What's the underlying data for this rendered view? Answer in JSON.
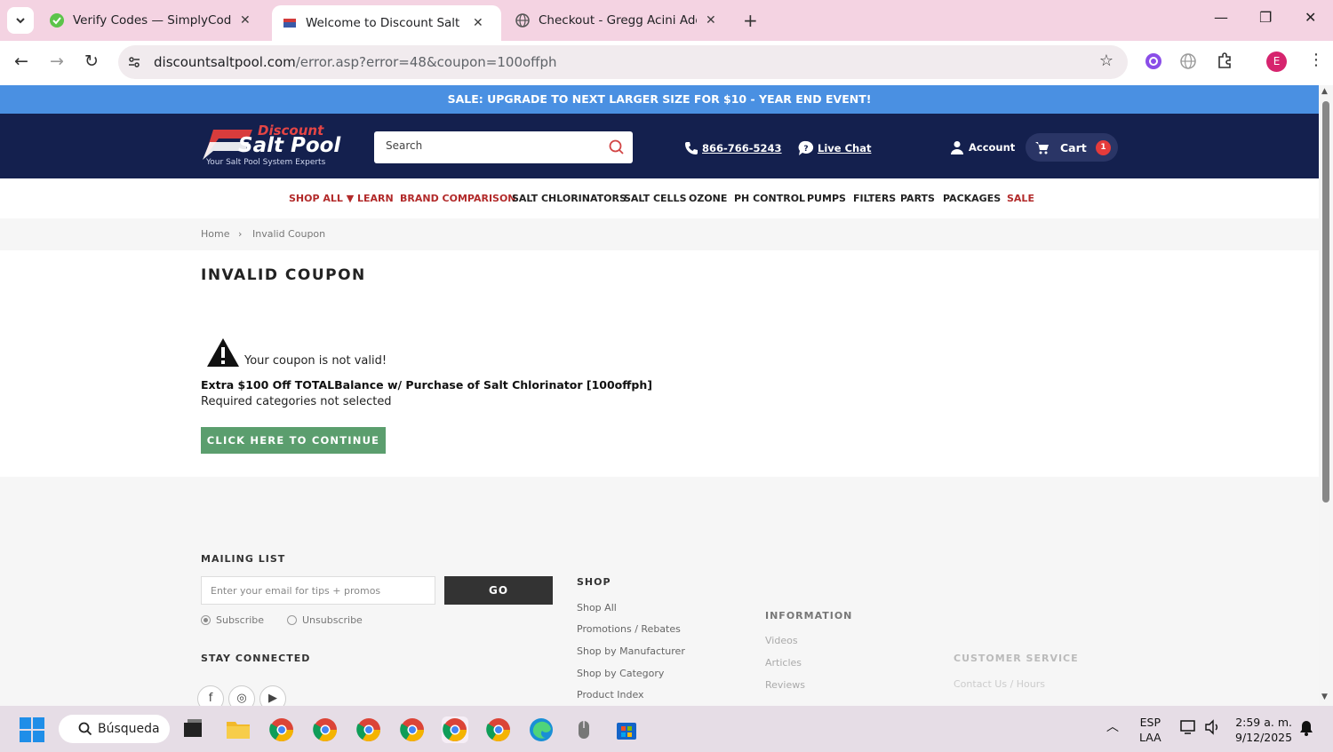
{
  "browser": {
    "tabs": [
      {
        "title": "Verify Codes — SimplyCodes",
        "active": false
      },
      {
        "title": "Welcome to Discount Salt Pool",
        "active": true
      },
      {
        "title": "Checkout - Gregg Acini Adoree",
        "active": false
      }
    ],
    "url_host": "discountsaltpool.com",
    "url_path": "/error.asp?error=48&coupon=100offph",
    "profile_initial": "E"
  },
  "site": {
    "sale_banner": "SALE: UPGRADE TO NEXT LARGER SIZE FOR $10 - YEAR END EVENT!",
    "logo": {
      "line1": "Discount",
      "line2": "Salt Pool",
      "tagline": "Your Salt Pool System Experts"
    },
    "search_placeholder": "Search",
    "phone": "866-766-5243",
    "live_chat": "Live Chat",
    "account": "Account",
    "cart_label": "Cart",
    "cart_count": "1",
    "nav": [
      {
        "label": "SHOP ALL ▼",
        "red": true
      },
      {
        "label": "LEARN",
        "red": true
      },
      {
        "label": "BRAND COMPARISON",
        "red": true
      },
      {
        "label": "SALT CHLORINATORS",
        "red": false
      },
      {
        "label": "SALT CELLS",
        "red": false
      },
      {
        "label": "OZONE",
        "red": false
      },
      {
        "label": "PH CONTROL",
        "red": false
      },
      {
        "label": "PUMPS",
        "red": false
      },
      {
        "label": "FILTERS",
        "red": false
      },
      {
        "label": "PARTS",
        "red": false
      },
      {
        "label": "PACKAGES",
        "red": false
      },
      {
        "label": "SALE",
        "red": true
      }
    ],
    "breadcrumb": {
      "home": "Home",
      "sep": "›",
      "current": "Invalid Coupon"
    }
  },
  "content": {
    "title": "INVALID COUPON",
    "message": "Your coupon is not valid!",
    "coupon_desc": "Extra $100 Off TOTALBalance w/ Purchase of Salt Chlorinator [100offph]",
    "reason": "Required categories not selected",
    "cta": "CLICK HERE TO CONTINUE"
  },
  "footer": {
    "mailing_heading": "MAILING LIST",
    "email_placeholder": "Enter your email for tips + promos",
    "go": "GO",
    "subscribe": "Subscribe",
    "unsubscribe": "Unsubscribe",
    "stay_connected": "STAY CONNECTED",
    "shop_heading": "SHOP",
    "shop_links": [
      "Shop All",
      "Promotions / Rebates",
      "Shop by Manufacturer",
      "Shop by Category",
      "Product Index"
    ],
    "info_heading": "INFORMATION",
    "info_links": [
      "Videos",
      "Articles",
      "Reviews"
    ],
    "cs_heading": "CUSTOMER SERVICE",
    "cs_links": [
      "Contact Us / Hours"
    ]
  },
  "taskbar": {
    "search": "Búsqueda",
    "lang": "ESP",
    "region": "LAA",
    "time": "2:59 a. m.",
    "date": "9/12/2025"
  },
  "colors": {
    "banner": "#4a90e2",
    "header": "#14204e",
    "nav_red": "#b22a2a",
    "cta_green": "#5b9e6e",
    "tabbar": "#f4d3e2"
  }
}
